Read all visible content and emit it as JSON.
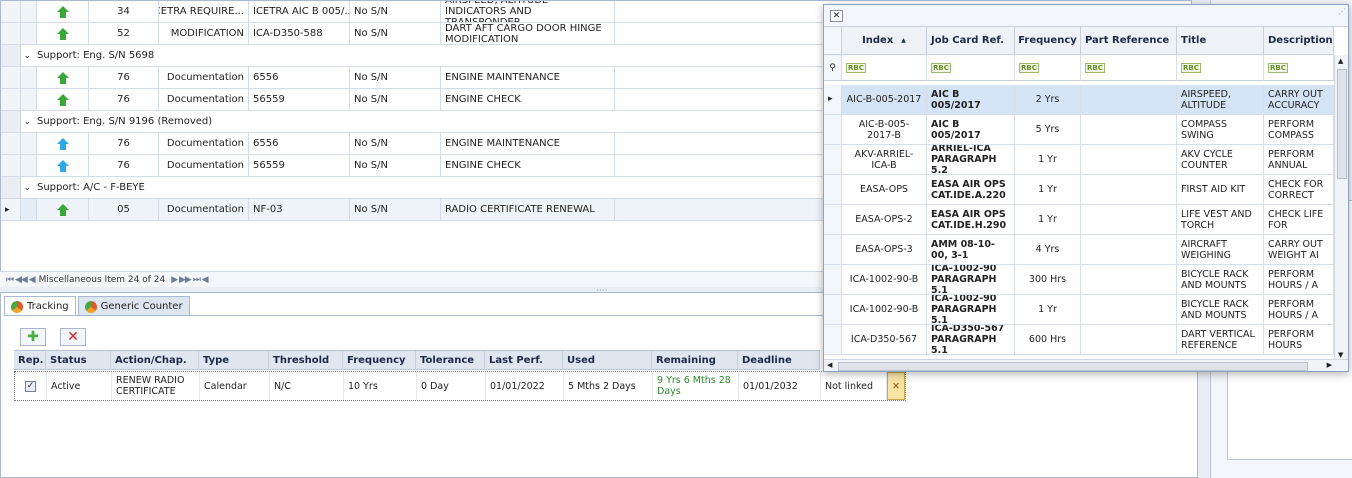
{
  "top_grid": {
    "rows": [
      {
        "kind": "data",
        "status": "green",
        "no": "34",
        "type": "ICETRA REQUIRE...",
        "ref": "ICETRA AIC B 005/...",
        "sn": "No S/N",
        "title": "AIRSPEED, ALTITUDE INDICATORS AND TRANSPONDER."
      },
      {
        "kind": "data",
        "status": "green",
        "no": "52",
        "type": "MODIFICATION",
        "ref": "ICA-D350-588",
        "sn": "No S/N",
        "title": "DART AFT CARGO DOOR HINGE MODIFICATION"
      },
      {
        "kind": "group",
        "label": "Support: Eng. S/N 5698"
      },
      {
        "kind": "data",
        "status": "green",
        "no": "76",
        "type": "Documentation",
        "ref": "6556",
        "sn": "No S/N",
        "title": "ENGINE MAINTENANCE"
      },
      {
        "kind": "data",
        "status": "green",
        "no": "76",
        "type": "Documentation",
        "ref": "56559",
        "sn": "No S/N",
        "title": "ENGINE CHECK"
      },
      {
        "kind": "group",
        "label": "Support: Eng. S/N 9196 (Removed)"
      },
      {
        "kind": "data",
        "status": "blue",
        "no": "76",
        "type": "Documentation",
        "ref": "6556",
        "sn": "No S/N",
        "title": "ENGINE MAINTENANCE"
      },
      {
        "kind": "data",
        "status": "blue",
        "no": "76",
        "type": "Documentation",
        "ref": "56559",
        "sn": "No S/N",
        "title": "ENGINE CHECK"
      },
      {
        "kind": "group",
        "label": "Support: A/C - F-BEYE"
      },
      {
        "kind": "data",
        "status": "green",
        "no": "05",
        "type": "Documentation",
        "ref": "NF-03",
        "sn": "No S/N",
        "title": "RADIO CERTIFICATE RENEWAL",
        "current": true
      }
    ],
    "nav_text": "Miscellaneous Item 24 of 24"
  },
  "tabs": [
    {
      "label": "Tracking",
      "active": true
    },
    {
      "label": "Generic Counter",
      "active": false
    }
  ],
  "tracking": {
    "headers": [
      "Rep.",
      "Status",
      "Action/Chap.",
      "Type",
      "Threshold",
      "Frequency",
      "Tolerance",
      "Last Perf.",
      "Used",
      "Remaining",
      "Deadline"
    ],
    "row": {
      "status": "Active",
      "action": "RENEW RADIO CERTIFICATE",
      "type": "Calendar",
      "threshold": "N/C",
      "frequency": "10 Yrs",
      "tolerance": "0 Day",
      "last_perf": "01/01/2022",
      "used": "5 Mths 2 Days",
      "remaining": "9 Yrs 6 Mths 28 Days",
      "deadline": "01/01/2032",
      "link": "Not linked"
    }
  },
  "popup": {
    "headers": [
      "Index",
      "Job Card Ref.",
      "Frequency",
      "Part Reference",
      "Title",
      "Description"
    ],
    "filter_text": "RBC",
    "rows": [
      {
        "index": "AIC-B-005-2017",
        "ref": "AIC B 005/2017",
        "freq": "2 Yrs",
        "part": "",
        "title": "AIRSPEED, ALTITUDE",
        "desc": "CARRY OUT ACCURACY",
        "selected": true
      },
      {
        "index": "AIC-B-005-2017-B",
        "ref": "AIC B 005/2017",
        "freq": "5 Yrs",
        "part": "",
        "title": "COMPASS SWING",
        "desc": "PERFORM COMPASS"
      },
      {
        "index": "AKV-ARRIEL-ICA-B",
        "ref": "ARRIEL-ICA PARAGRAPH 5.2",
        "freq": "1 Yr",
        "part": "",
        "title": "AKV CYCLE COUNTER",
        "desc": "PERFORM ANNUAL"
      },
      {
        "index": "EASA-OPS",
        "ref": "EASA AIR OPS CAT.IDE.A.220",
        "freq": "1 Yr",
        "part": "",
        "title": "FIRST AID KIT",
        "desc": "CHECK FOR CORRECT"
      },
      {
        "index": "EASA-OPS-2",
        "ref": "EASA AIR OPS CAT.IDE.H.290",
        "freq": "1 Yr",
        "part": "",
        "title": "LIFE VEST AND TORCH",
        "desc": "CHECK LIFE FOR"
      },
      {
        "index": "EASA-OPS-3",
        "ref": "AMM 08-10-00, 3-1",
        "freq": "4 Yrs",
        "part": "",
        "title": "AIRCRAFT WEIGHING",
        "desc": "CARRY OUT WEIGHT AI"
      },
      {
        "index": "ICA-1002-90-B",
        "ref": "ICA-1002-90 PARAGRAPH 5.1",
        "freq": "300 Hrs",
        "part": "",
        "title": "BICYCLE RACK AND MOUNTS",
        "desc": "PERFORM HOURS / A"
      },
      {
        "index": "ICA-1002-90-B",
        "ref": "ICA-1002-90 PARAGRAPH 5.1",
        "freq": "1 Yr",
        "part": "",
        "title": "BICYCLE RACK AND MOUNTS",
        "desc": "PERFORM HOURS / A"
      },
      {
        "index": "ICA-D350-567",
        "ref": "ICA-D350-567 PARAGRAPH 5.1",
        "freq": "600 Hrs",
        "part": "",
        "title": "DART VERTICAL REFERENCE",
        "desc": "PERFORM HOURS"
      }
    ]
  },
  "colors": {
    "accent": "#1d6fc7",
    "remaining_text": "#2a8a2a",
    "selected_row": "#d4e4f6"
  }
}
